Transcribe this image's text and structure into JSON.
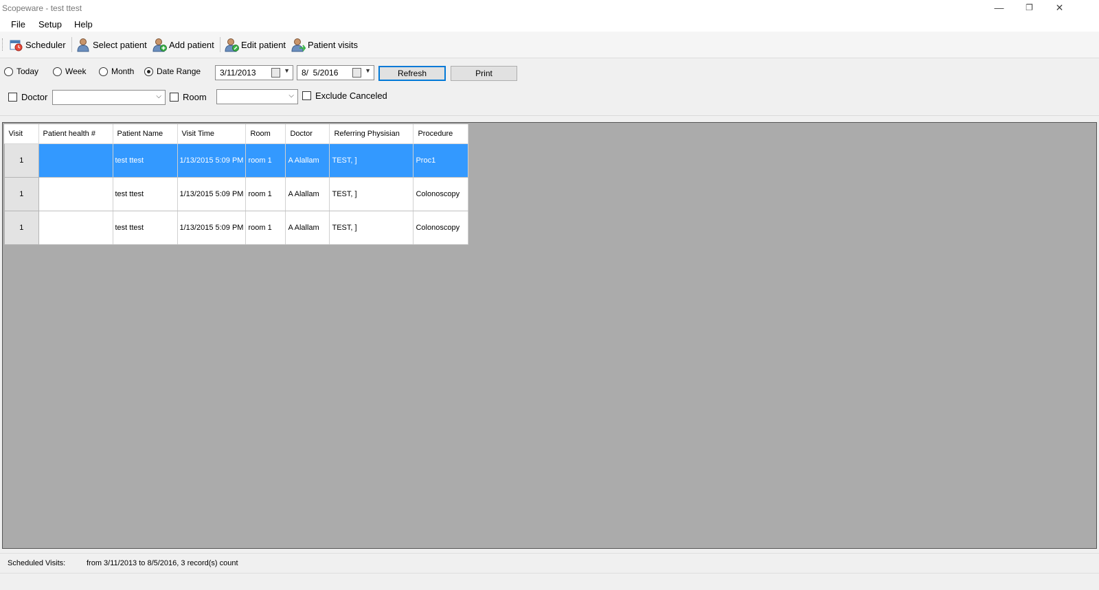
{
  "window": {
    "title": "Scopeware - test ttest",
    "minimize": "—",
    "restore": "❐",
    "close": "✕"
  },
  "menu": [
    "File",
    "Setup",
    "Help"
  ],
  "toolbar": {
    "scheduler": "Scheduler",
    "select_patient": "Select patient",
    "add_patient": "Add patient",
    "edit_patient": "Edit patient",
    "patient_visits": "Patient visits"
  },
  "filters": {
    "today": "Today",
    "week": "Week",
    "month": "Month",
    "date_range": "Date Range",
    "selected_range": "Date Range",
    "date_from": "3/11/2013",
    "date_to": "8/  5/2016",
    "refresh": "Refresh",
    "print": "Print",
    "doctor": "Doctor",
    "doctor_value": "",
    "room": "Room",
    "room_value": "",
    "exclude_canceled": "Exclude Canceled"
  },
  "table": {
    "columns": [
      "Visit",
      "Patient health #",
      "Patient Name",
      "Visit Time",
      "Room",
      "Doctor",
      "Referring Physisian",
      "Procedure"
    ],
    "rows": [
      {
        "visit": "1",
        "health": "",
        "name": "test ttest",
        "time": "1/13/2015 5:09 PM",
        "room": "room 1",
        "doctor": "A Alallam",
        "referring": "TEST, ]",
        "procedure": "Proc1"
      },
      {
        "visit": "1",
        "health": "",
        "name": "test ttest",
        "time": "1/13/2015 5:09 PM",
        "room": "room 1",
        "doctor": "A Alallam",
        "referring": "TEST, ]",
        "procedure": "Colonoscopy"
      },
      {
        "visit": "1",
        "health": "",
        "name": "test ttest",
        "time": "1/13/2015 5:09 PM",
        "room": "room 1",
        "doctor": "A Alallam",
        "referring": "TEST, ]",
        "procedure": "Colonoscopy"
      }
    ],
    "selected_row": 0
  },
  "status": {
    "label": "Scheduled Visits:",
    "text": "from 3/11/2013 to 8/5/2016, 3 record(s) count"
  },
  "colors": {
    "selection": "#3399ff",
    "grid_background": "#ababab",
    "focus_border": "#0078d7"
  },
  "icons": [
    "scheduler-icon",
    "select-patient-icon",
    "add-patient-icon",
    "edit-patient-icon",
    "patient-visits-icon",
    "calendar-icon",
    "dropdown-arrow-icon"
  ]
}
